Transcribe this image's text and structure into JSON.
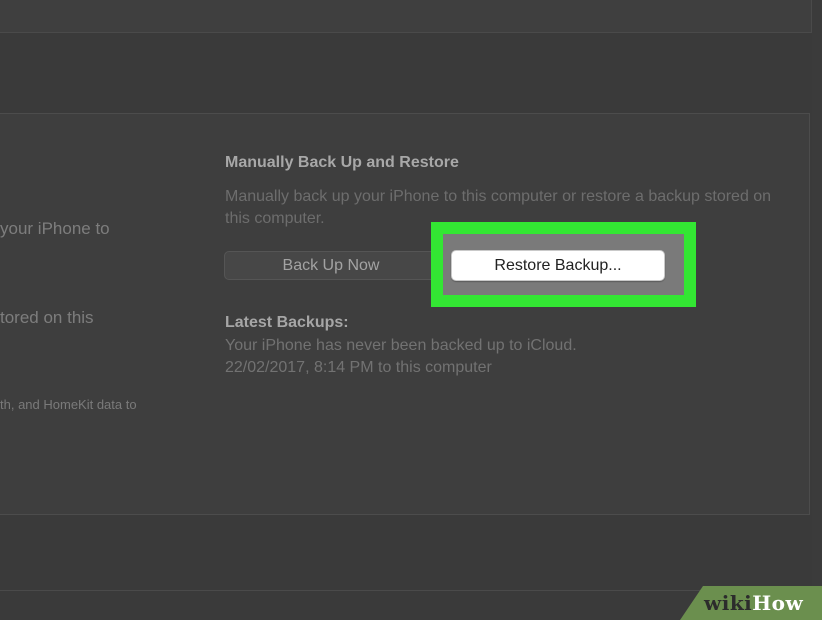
{
  "left_column": {
    "line1": "your iPhone to",
    "line2": "tored on this",
    "line3": "th, and HomeKit data to"
  },
  "manual_backup": {
    "heading": "Manually Back Up and Restore",
    "description": "Manually back up your iPhone to this computer or restore a backup stored on this computer.",
    "back_up_now_label": "Back Up Now",
    "restore_backup_label": "Restore Backup..."
  },
  "latest_backups": {
    "title": "Latest Backups:",
    "icloud_line": "Your iPhone has never been backed up to iCloud.",
    "computer_line": "22/02/2017, 8:14 PM to this computer"
  },
  "watermark": {
    "part1": "wiki",
    "part2": "How"
  },
  "colors": {
    "highlight": "#33e633",
    "watermark_bg": "#6b8f4e"
  }
}
